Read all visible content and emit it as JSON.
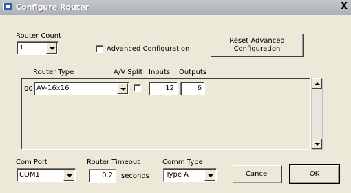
{
  "window": {
    "title": "Configure Router",
    "close_label": "X"
  },
  "router_count": {
    "label": "Router Count",
    "value": "1"
  },
  "advanced_config": {
    "label": "Advanced Configuration",
    "checked": false
  },
  "reset_button": {
    "label_line1": "Reset Advanced",
    "label_line2": "Configuration"
  },
  "table": {
    "headers": {
      "router_type": "Router Type",
      "av_split": "A/V Split",
      "inputs": "Inputs",
      "outputs": "Outputs"
    },
    "rows": [
      {
        "index": "00",
        "router_type": "AV-16x16",
        "av_split": false,
        "inputs": "12",
        "outputs": "6"
      }
    ]
  },
  "com_port": {
    "label": "Com Port",
    "value": "COM1"
  },
  "router_timeout": {
    "label": "Router Timeout",
    "value": "0.2",
    "unit": "seconds"
  },
  "comm_type": {
    "label": "Comm Type",
    "value": "Type A"
  },
  "buttons": {
    "cancel_rest": "ancel",
    "cancel_mnemonic": "C",
    "ok_rest": "K",
    "ok_mnemonic": "O"
  }
}
